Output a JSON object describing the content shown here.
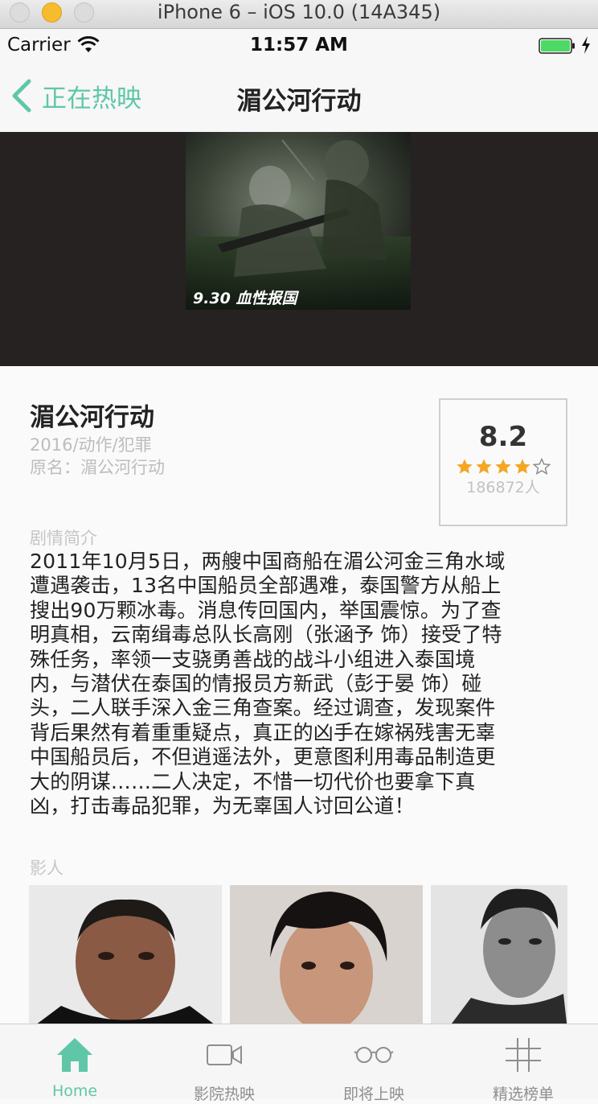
{
  "simulator": {
    "title": "iPhone 6 – iOS 10.0 (14A345)"
  },
  "status_bar": {
    "carrier": "Carrier",
    "time": "11:57 AM"
  },
  "nav": {
    "back_label": "正在热映",
    "title": "湄公河行动"
  },
  "poster": {
    "caption": "9.30 血性报国"
  },
  "movie": {
    "title": "湄公河行动",
    "year_genre": "2016/动作/犯罪",
    "original_name": "原名：湄公河行动"
  },
  "rating": {
    "score": "8.2",
    "stars_filled": 4,
    "stars_total": 5,
    "count": "186872人"
  },
  "synopsis": {
    "label": "剧情简介",
    "lines": [
      "2011年10月5日，两艘中国商船在湄公河金三角水域",
      "遭遇袭击，13名中国船员全部遇难，泰国警方从船上",
      "搜出90万颗冰毒。消息传回国内，举国震惊。为了查",
      "明真相，云南缉毒总队长高刚（张涵予 饰）接受了特",
      "殊任务，率领一支骁勇善战的战斗小组进入泰国境",
      "内，与潜伏在泰国的情报员方新武（彭于晏 饰）碰",
      "头，二人联手深入金三角查案。经过调查，发现案件",
      "背后果然有着重重疑点，真正的凶手在嫁祸残害无辜",
      "中国船员后，不但逍遥法外，更意图利用毒品制造更",
      "大的阴谋……二人决定，不惜一切代价也要拿下真",
      "凶，打击毒品犯罪，为无辜国人讨回公道！"
    ]
  },
  "cast": {
    "label": "影人"
  },
  "tabs": [
    {
      "label": "Home",
      "icon": "home-icon",
      "active": true
    },
    {
      "label": "影院热映",
      "icon": "video-camera-icon",
      "active": false
    },
    {
      "label": "即将上映",
      "icon": "glasses-icon",
      "active": false
    },
    {
      "label": "精选榜单",
      "icon": "hashtag-icon",
      "active": false
    }
  ],
  "colors": {
    "accent": "#5fc7a8",
    "star": "#f5a623",
    "hero_bg": "#262222"
  }
}
